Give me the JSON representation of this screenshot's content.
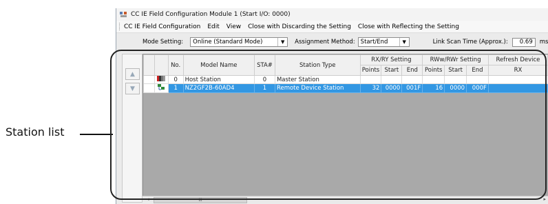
{
  "callout": {
    "label": "Station list"
  },
  "window": {
    "title": "CC IE Field Configuration Module 1 (Start I/O: 0000)"
  },
  "menu": [
    "CC IE Field Configuration",
    "Edit",
    "View",
    "Close with Discarding the Setting",
    "Close with Reflecting the Setting"
  ],
  "mode": {
    "mode_label": "Mode Setting:",
    "mode_value": "Online (Standard Mode)",
    "assign_label": "Assignment Method:",
    "assign_value": "Start/End",
    "link_label": "Link Scan Time (Approx.):",
    "link_value": "0.69",
    "link_unit": "ms"
  },
  "nav": {
    "up_icon": "triangle-up-icon",
    "down_icon": "triangle-down-icon"
  },
  "table": {
    "headers": {
      "no": "No.",
      "model": "Model Name",
      "sta": "STA#",
      "station_type": "Station Type",
      "rxry": "RX/RY Setting",
      "rwwrwr": "RWw/RWr Setting",
      "refresh": "Refresh Device",
      "points": "Points",
      "start": "Start",
      "end": "End",
      "rx": "RX"
    },
    "rows": [
      {
        "icon": "plc-icon",
        "no": "0",
        "model": "Host Station",
        "sta": "0",
        "type": "Master Station",
        "rx_points": "",
        "rx_start": "",
        "rx_end": "",
        "rw_points": "",
        "rw_start": "",
        "rw_end": "",
        "refresh_rx": ""
      },
      {
        "icon": "remote-device-icon",
        "no": "1",
        "model": "NZ2GF2B-60AD4",
        "sta": "1",
        "type": "Remote Device Station",
        "rx_points": "32",
        "rx_start": "0000",
        "rx_end": "001F",
        "rw_points": "16",
        "rw_start": "0000",
        "rw_end": "000F",
        "refresh_rx": ""
      }
    ]
  },
  "scroll": {
    "thumb_text": "III"
  },
  "colors": {
    "selection": "#3297e3",
    "grid_bg": "#a9a9a9"
  }
}
